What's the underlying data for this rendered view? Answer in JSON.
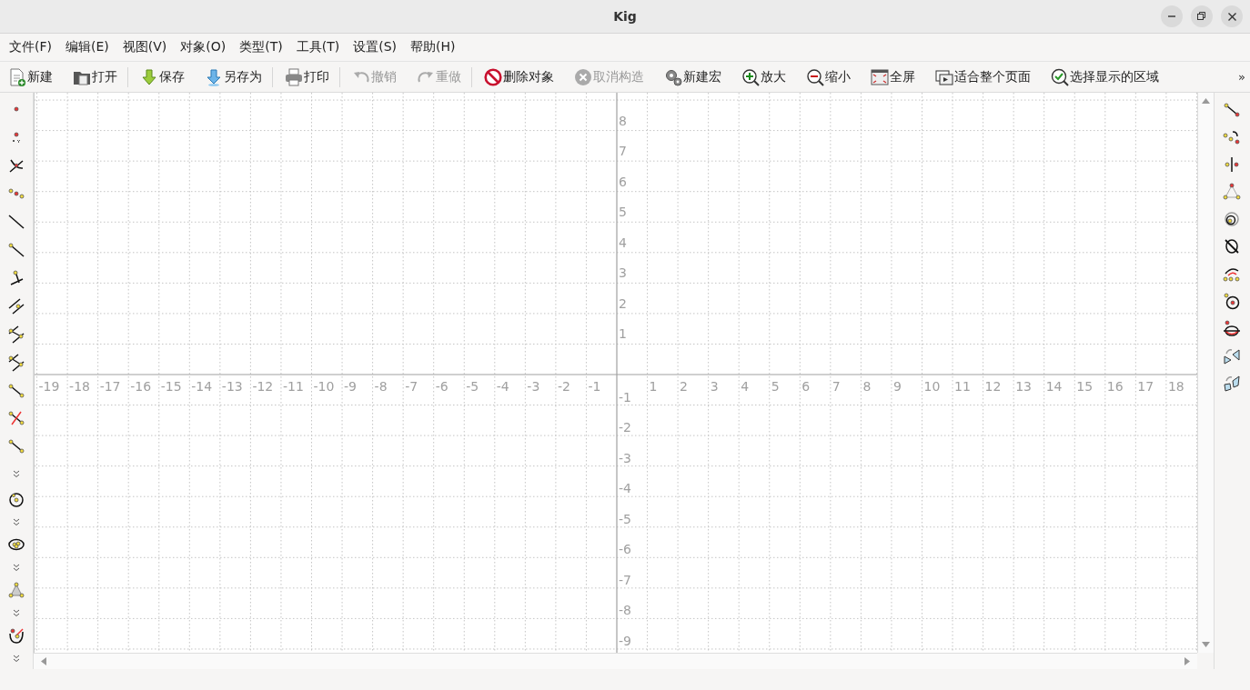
{
  "window": {
    "title": "Kig"
  },
  "menu": [
    "文件(F)",
    "编辑(E)",
    "视图(V)",
    "对象(O)",
    "类型(T)",
    "工具(T)",
    "设置(S)",
    "帮助(H)"
  ],
  "toolbar": {
    "buttons": [
      {
        "label": "新建",
        "disabled": false,
        "separator_before": false
      },
      {
        "label": "打开",
        "disabled": false,
        "separator_before": false
      },
      {
        "label": "保存",
        "disabled": false,
        "separator_before": true
      },
      {
        "label": "另存为",
        "disabled": false,
        "separator_before": false
      },
      {
        "label": "打印",
        "disabled": false,
        "separator_before": true
      },
      {
        "label": "撤销",
        "disabled": true,
        "separator_before": true
      },
      {
        "label": "重做",
        "disabled": true,
        "separator_before": false
      },
      {
        "label": "删除对象",
        "disabled": false,
        "separator_before": true
      },
      {
        "label": "取消构造",
        "disabled": true,
        "separator_before": false
      },
      {
        "label": "新建宏",
        "disabled": false,
        "separator_before": false
      },
      {
        "label": "放大",
        "disabled": false,
        "separator_before": false
      },
      {
        "label": "缩小",
        "disabled": false,
        "separator_before": false
      },
      {
        "label": "全屏",
        "disabled": false,
        "separator_before": false
      },
      {
        "label": "适合整个页面",
        "disabled": false,
        "separator_before": false
      },
      {
        "label": "选择显示的区域",
        "disabled": false,
        "separator_before": false
      }
    ],
    "overflow": "»"
  },
  "canvas": {
    "x_axis": {
      "negative": [
        "-19",
        "-18",
        "-17",
        "-16",
        "-15",
        "-14",
        "-13",
        "-12",
        "-11",
        "-10",
        "-9",
        "-8",
        "-7",
        "-6",
        "-5",
        "-4",
        "-3",
        "-2",
        "-1"
      ],
      "positive": [
        "1",
        "2",
        "3",
        "4",
        "5",
        "6",
        "7",
        "8",
        "9",
        "10",
        "11",
        "12",
        "13",
        "14",
        "15",
        "16",
        "17",
        "18"
      ]
    },
    "y_axis": {
      "positive": [
        "8",
        "7",
        "6",
        "5",
        "4",
        "3",
        "2",
        "1"
      ],
      "negative": [
        "-1",
        "-2",
        "-3",
        "-4",
        "-5",
        "-6",
        "-7",
        "-8",
        "-9"
      ]
    }
  }
}
